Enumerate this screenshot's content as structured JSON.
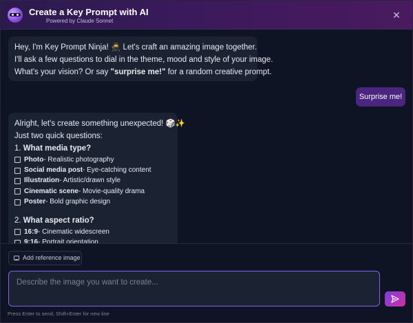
{
  "header": {
    "title": "Create a Key Prompt with AI",
    "subtitle": "Powered by Claude Sonnet",
    "close_label": "✕"
  },
  "messages": {
    "intro": {
      "line1_pre": "Hey, I'm Key Prompt Ninja! ",
      "line1_emoji": "🥷",
      "line1_post": " Let's craft an amazing image together.",
      "line2": "I'll ask a few questions to dial in the theme, mood and style of your image.",
      "line3_pre": "What's your vision? Or say ",
      "line3_bold": "\"surprise me!\"",
      "line3_post": " for a random creative prompt."
    },
    "user": "Surprise me!",
    "reply": {
      "line1": "Alright, let's create something unexpected! 🎲✨",
      "line2": "Just two quick questions:",
      "q1_num": "1. ",
      "q1": "What media type?",
      "media_options": [
        {
          "label": "Photo",
          "desc": " - Realistic photography"
        },
        {
          "label": "Social media post",
          "desc": " - Eye-catching content"
        },
        {
          "label": "Illustration",
          "desc": " - Artistic/drawn style"
        },
        {
          "label": "Cinematic scene",
          "desc": " - Movie-quality drama"
        },
        {
          "label": "Poster",
          "desc": " - Bold graphic design"
        }
      ],
      "q2_num": "2. ",
      "q2": "What aspect ratio?",
      "ratio_options": [
        {
          "label": "16:9",
          "desc": " - Cinematic widescreen"
        },
        {
          "label": "9:16",
          "desc": " - Portrait orientation"
        }
      ]
    }
  },
  "composer": {
    "ref_label": "Add reference image",
    "placeholder": "Describe the image you want to create...",
    "value": "",
    "hint": "Press Enter to send, Shift+Enter for new line"
  },
  "colors": {
    "accent": "#8a5cf0",
    "user_bubble": "#4b2680",
    "ai_bubble": "#1b2333"
  }
}
